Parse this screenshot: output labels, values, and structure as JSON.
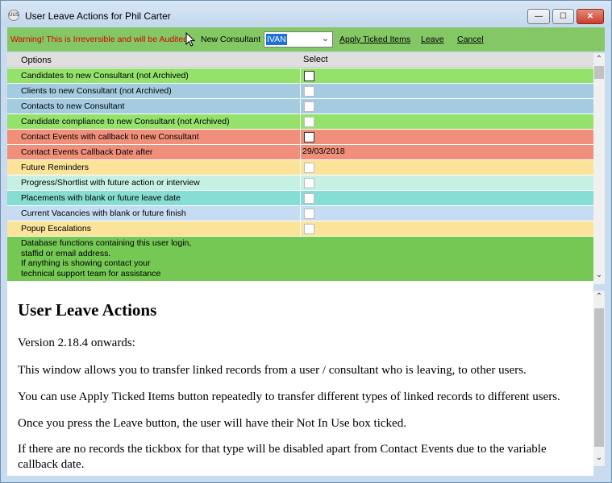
{
  "window": {
    "title": "User Leave Actions for Phil Carter",
    "app_icon_text": "UUS",
    "minimize_glyph": "—",
    "maximize_glyph": "☐",
    "close_glyph": "✕"
  },
  "toolbar": {
    "warning": "Warning! This is Irreversible and will be Audited",
    "new_consultant_label": "New Consultant",
    "consultant_value": "IVAN",
    "apply_label": "Apply Ticked Items",
    "leave_label": "Leave",
    "cancel_label": "Cancel"
  },
  "grid": {
    "columns": [
      "Options",
      "Select"
    ],
    "rows": [
      {
        "option": "Candidates to new Consultant (not Archived)",
        "color": "#94e26c",
        "checkbox_enabled": true
      },
      {
        "option": "Clients to new Consultant (not Archived)",
        "color": "#a4cbe0",
        "checkbox_enabled": false
      },
      {
        "option": "Contacts to new Consultant",
        "color": "#a4cbe0",
        "checkbox_enabled": false
      },
      {
        "option": "Candidate compliance to new Consultant (not Archived)",
        "color": "#94e26c",
        "checkbox_enabled": false
      },
      {
        "option": "Contact Events with callback to new Consultant",
        "color": "#f1907a",
        "checkbox_enabled": true
      },
      {
        "option": "Contact Events Callback Date after",
        "color": "#f1907a",
        "date": "29/03/2018"
      },
      {
        "option": "Future Reminders",
        "color": "#fbe39a",
        "checkbox_enabled": false
      },
      {
        "option": "Progress/Shortlist with future action or interview",
        "color": "#c6f1e2",
        "checkbox_enabled": false
      },
      {
        "option": "Placements with  blank or future leave date",
        "color": "#86ddd3",
        "checkbox_enabled": false
      },
      {
        "option": "Current Vacancies with blank or future finish",
        "color": "#c6dcf2",
        "checkbox_enabled": false
      },
      {
        "option": "Popup Escalations",
        "color": "#fbe39a",
        "checkbox_enabled": false
      }
    ],
    "note": {
      "lines": [
        "Database functions containing this user login,",
        "staffid or email address.",
        "If anything is showing contact your",
        "technical support team for assistance"
      ],
      "color": "#74c853"
    }
  },
  "help": {
    "heading": "User Leave Actions",
    "version": "Version 2.18.4 onwards:",
    "p1": "This window allows you to transfer linked records from a user / consultant who is leaving, to other users.",
    "p2": "You can use Apply Ticked Items button repeatedly to transfer different types of linked records to different users.",
    "p3": "Once you press the Leave button, the user will have their Not In Use box ticked.",
    "p4": "If there are no records the tickbox for that type will be disabled apart from Contact Events due to the variable callback date."
  }
}
